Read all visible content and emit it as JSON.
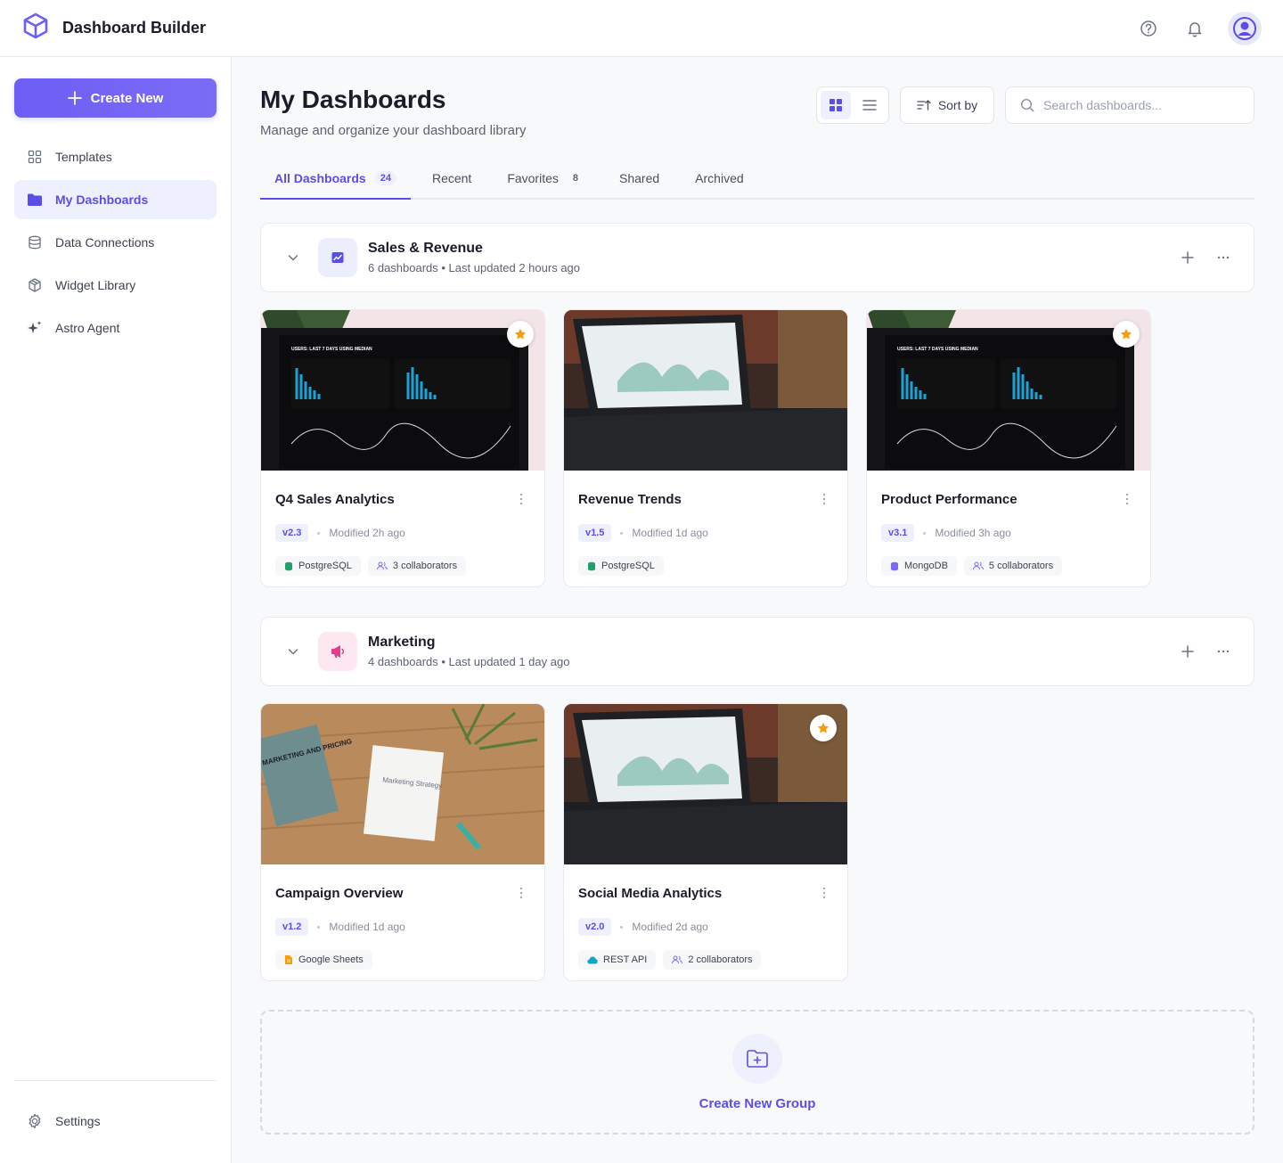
{
  "app": {
    "title": "Dashboard Builder"
  },
  "header_icons": [
    "help-icon",
    "bell-icon",
    "user-avatar-icon"
  ],
  "sidebar": {
    "create_label": "Create New",
    "items": [
      {
        "label": "Templates",
        "icon": "grid-icon"
      },
      {
        "label": "My Dashboards",
        "icon": "folder-icon",
        "active": true
      },
      {
        "label": "Data Connections",
        "icon": "database-icon"
      },
      {
        "label": "Widget Library",
        "icon": "cube-icon"
      },
      {
        "label": "Astro Agent",
        "icon": "sparkle-icon"
      }
    ],
    "settings_label": "Settings"
  },
  "page": {
    "title": "My Dashboards",
    "subtitle": "Manage and organize your dashboard library",
    "sort_label": "Sort by",
    "search_placeholder": "Search dashboards...",
    "view_mode": "grid"
  },
  "tabs": [
    {
      "label": "All Dashboards",
      "count": "24",
      "active": true
    },
    {
      "label": "Recent",
      "count": ""
    },
    {
      "label": "Favorites",
      "count": "8"
    },
    {
      "label": "Shared",
      "count": ""
    },
    {
      "label": "Archived",
      "count": ""
    }
  ],
  "groups": [
    {
      "name": "Sales & Revenue",
      "meta": "6 dashboards • Last updated 2 hours ago",
      "icon": "chart-icon",
      "color": "#5b4ee8",
      "cards": [
        {
          "title": "Q4 Sales Analytics",
          "version": "v2.3",
          "modified": "Modified 2h ago",
          "source": "PostgreSQL",
          "source_color": "#22a06b",
          "collaborators": "3 collaborators",
          "favorite": true,
          "thumb": "monitor"
        },
        {
          "title": "Revenue Trends",
          "version": "v1.5",
          "modified": "Modified 1d ago",
          "source": "PostgreSQL",
          "source_color": "#22a06b",
          "collaborators": "",
          "favorite": false,
          "thumb": "laptop"
        },
        {
          "title": "Product Performance",
          "version": "v3.1",
          "modified": "Modified 3h ago",
          "source": "MongoDB",
          "source_color": "#7b6cf6",
          "collaborators": "5 collaborators",
          "favorite": true,
          "thumb": "monitor"
        }
      ]
    },
    {
      "name": "Marketing",
      "meta": "4 dashboards • Last updated 1 day ago",
      "icon": "megaphone-icon",
      "color": "#e23d8a",
      "cards": [
        {
          "title": "Campaign Overview",
          "version": "v1.2",
          "modified": "Modified 1d ago",
          "source": "Google Sheets",
          "source_color": "#f59e0b",
          "collaborators": "",
          "favorite": false,
          "thumb": "desk"
        },
        {
          "title": "Social Media Analytics",
          "version": "v2.0",
          "modified": "Modified 2d ago",
          "source": "REST API",
          "source_color": "#0ea5c6",
          "collaborators": "2 collaborators",
          "favorite": true,
          "thumb": "laptop"
        }
      ]
    }
  ],
  "thumb_text": {
    "monitor_header": "USERS: LAST 7 DAYS USING MEDIAN",
    "desk_book": "MARKETING AND PRICING",
    "desk_paper": "Marketing Strategy"
  },
  "new_group_label": "Create New Group"
}
